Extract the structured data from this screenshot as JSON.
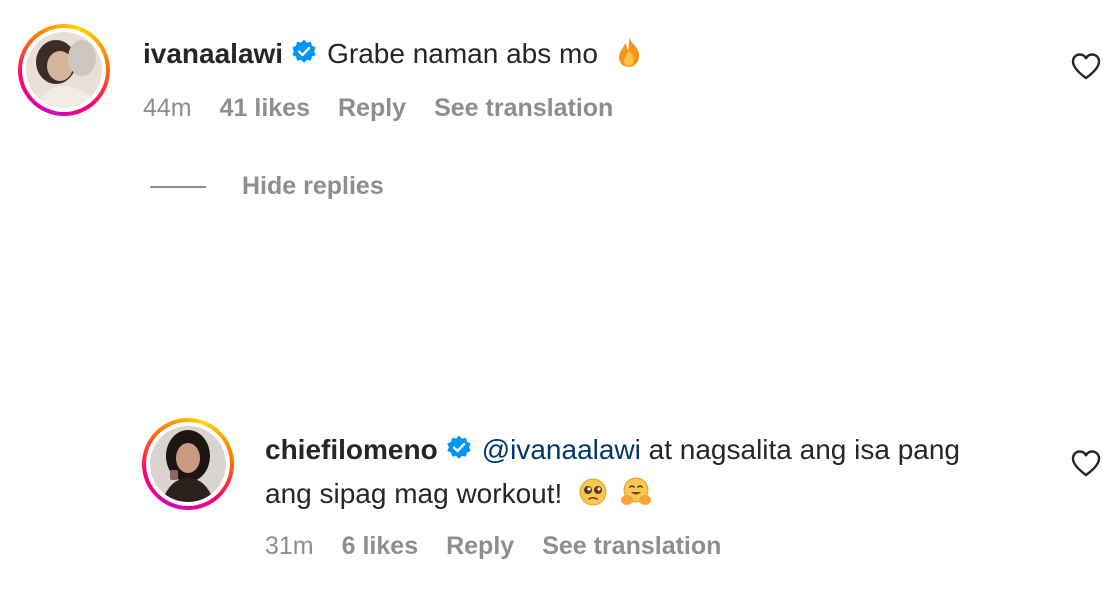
{
  "comment": {
    "username": "ivanaalawi",
    "text": "Grabe naman abs mo",
    "emoji": "fire-emoji",
    "time": "44m",
    "likes": "41 likes",
    "reply_label": "Reply",
    "translate_label": "See translation"
  },
  "hide_replies_label": "Hide replies",
  "reply": {
    "username": "chiefilomeno",
    "mention": "@ivanaalawi",
    "text_line1": " at nagsalita ang isa pang",
    "text_line2": "ang sipag mag workout!",
    "emojis": [
      "pleading-face-emoji",
      "hugging-face-emoji"
    ],
    "time": "31m",
    "likes": "6 likes",
    "reply_label": "Reply",
    "translate_label": "See translation"
  },
  "colors": {
    "verified": "#0095f6",
    "mention": "#00376b",
    "muted": "#8e8e8e",
    "text": "#262626"
  }
}
